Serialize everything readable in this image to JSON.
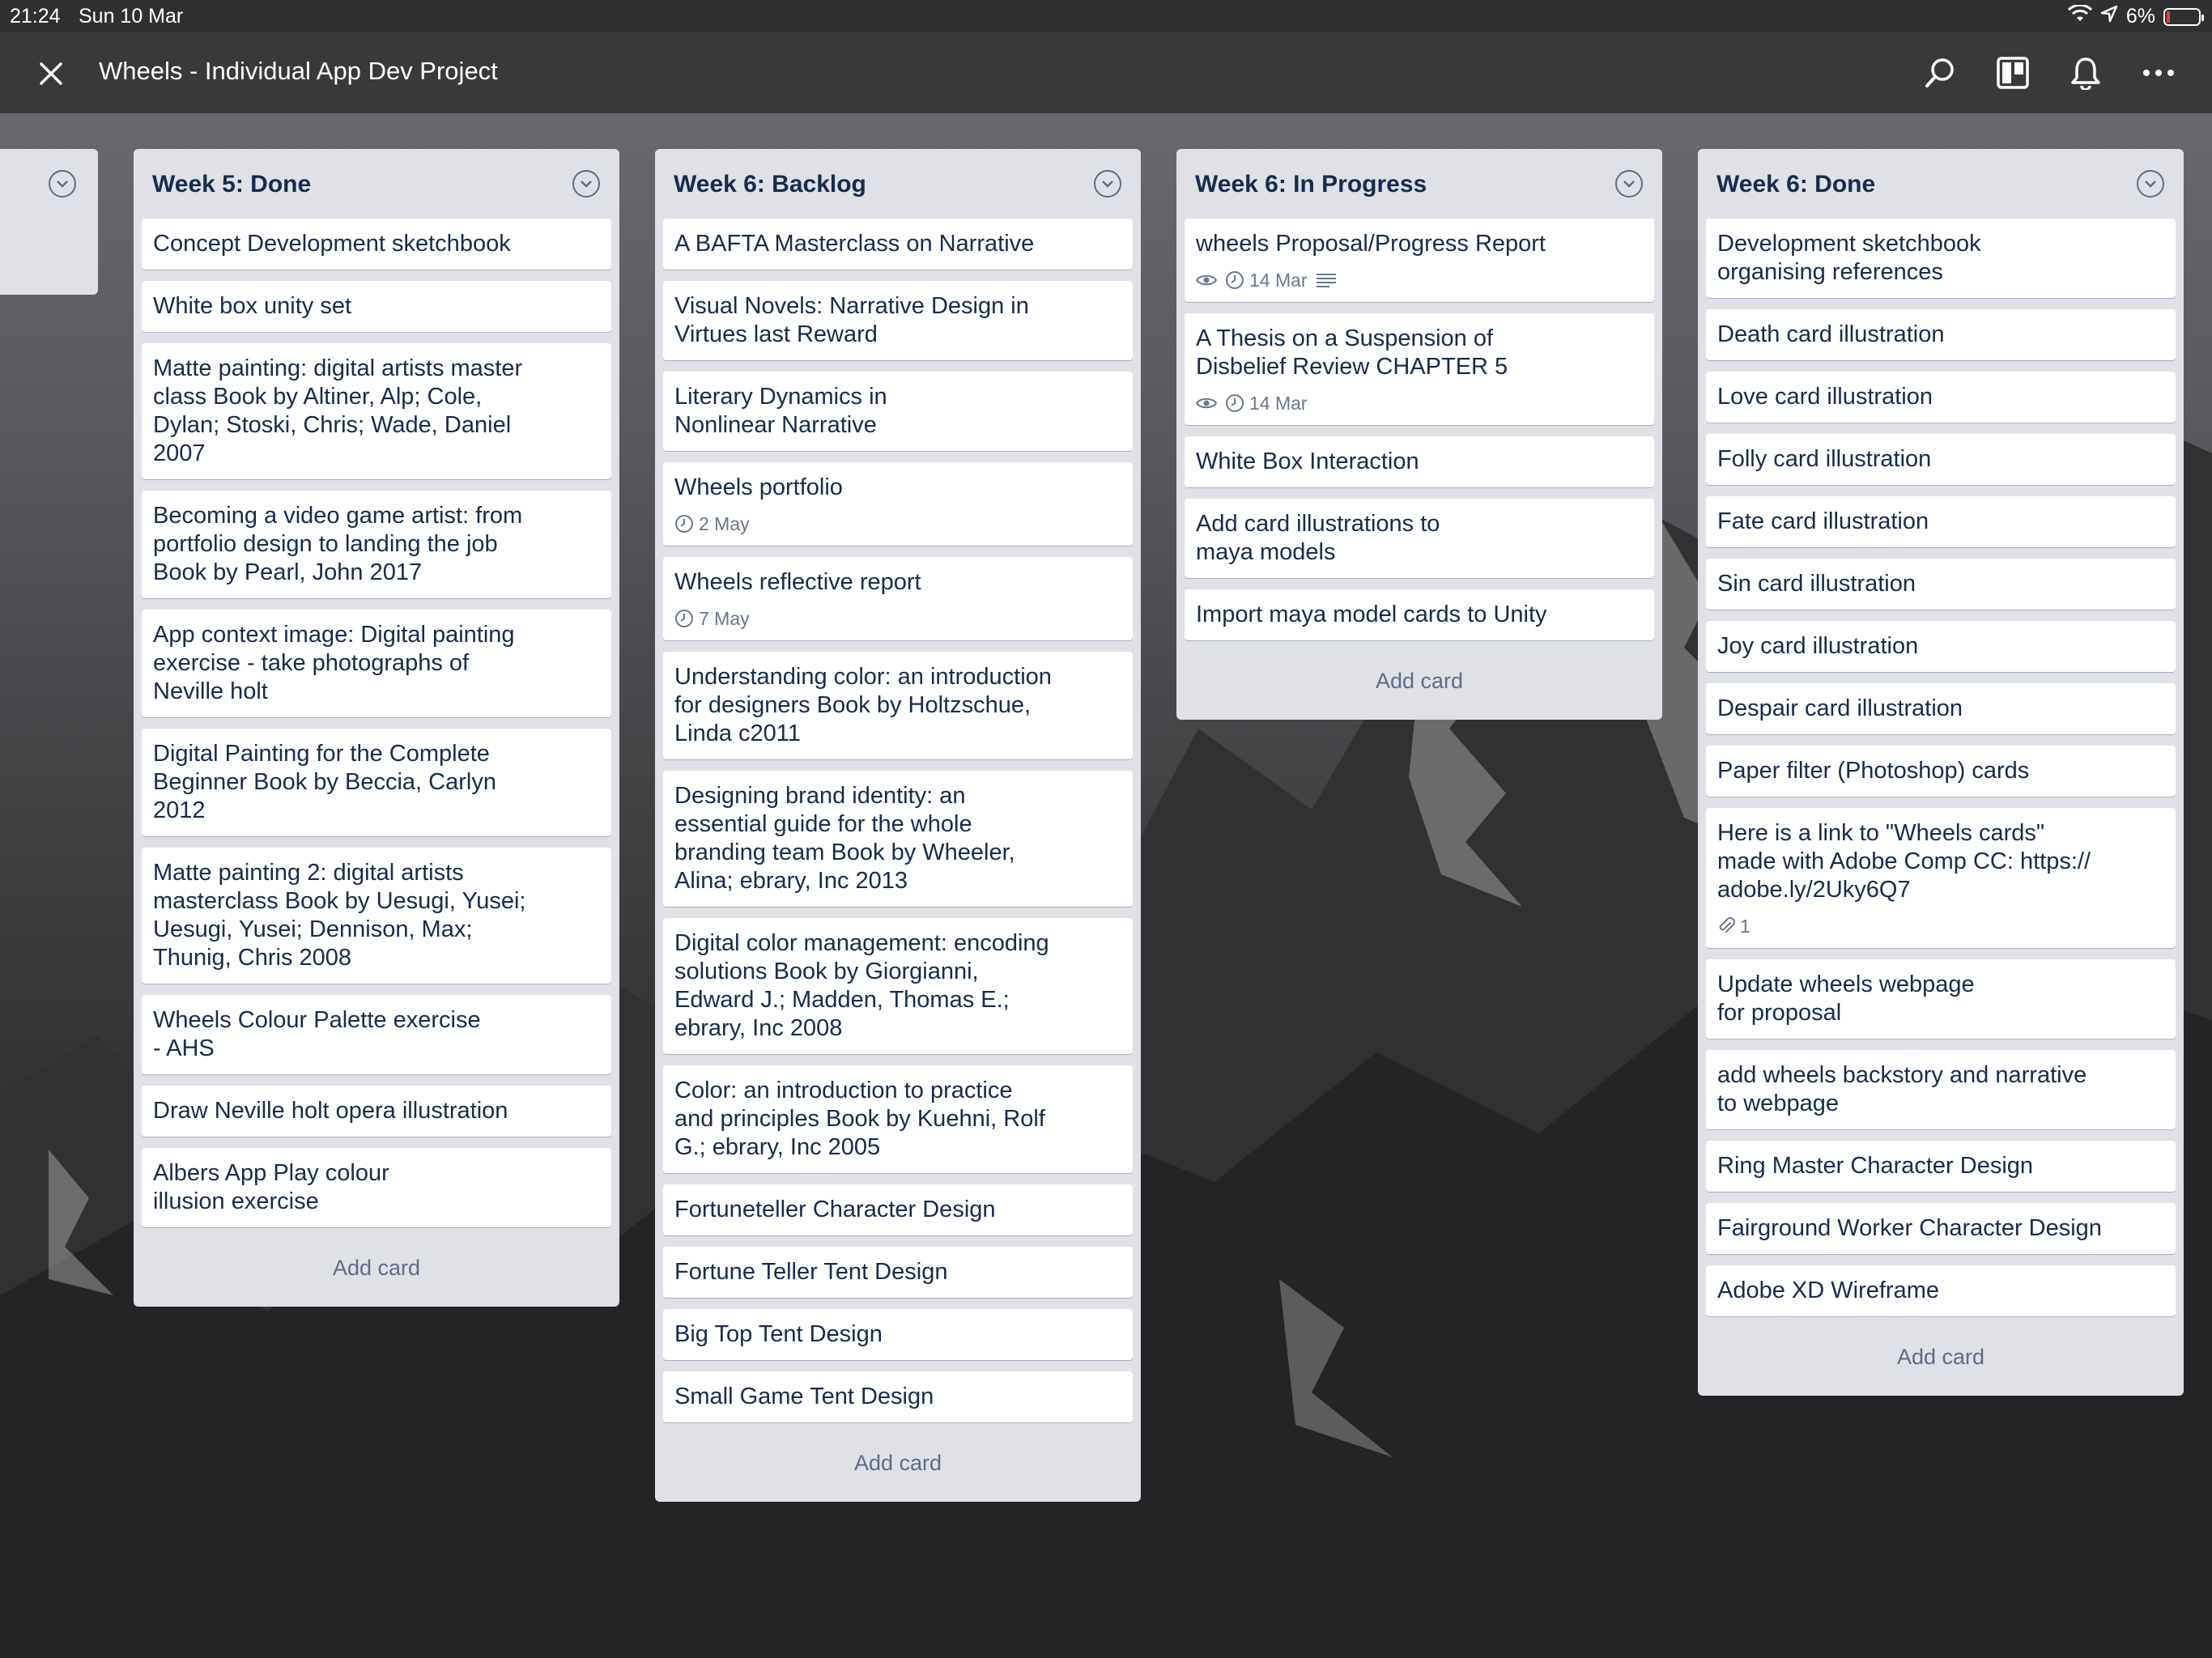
{
  "status_bar": {
    "time": "21:24",
    "date": "Sun 10 Mar",
    "battery": "6%"
  },
  "header": {
    "title": "Wheels - Individual App Dev Project",
    "close_icon": "close-icon",
    "icons": [
      "search-icon",
      "board-view-icon",
      "bell-icon",
      "more-icon"
    ]
  },
  "lists": [
    {
      "title": "Week 5: Done",
      "cards": [
        {
          "text": "Concept Development sketchbook"
        },
        {
          "text": "White box unity set"
        },
        {
          "text": "Matte painting: digital artists master\nclass Book  by Altiner, Alp; Cole,\nDylan; Stoski, Chris; Wade, Daniel\n2007"
        },
        {
          "text": "Becoming a video game artist: from\nportfolio design to landing the job\nBook  by Pearl, John  2017"
        },
        {
          "text": "App context image: Digital painting\nexercise - take photographs of\nNeville holt"
        },
        {
          "text": "Digital Painting for the Complete\nBeginner Book  by Beccia, Carlyn\n2012"
        },
        {
          "text": "Matte painting 2: digital artists\nmasterclass Book  by Uesugi, Yusei;\nUesugi, Yusei; Dennison, Max;\nThunig, Chris  2008"
        },
        {
          "text": "Wheels Colour Palette exercise\n- AHS"
        },
        {
          "text": "Draw Neville holt opera illustration"
        },
        {
          "text": "Albers App Play colour\nillusion exercise"
        }
      ],
      "add_label": "Add card"
    },
    {
      "title": "Week 6: Backlog",
      "cards": [
        {
          "text": "A BAFTA Masterclass on Narrative"
        },
        {
          "text": "Visual Novels: Narrative Design in\nVirtues last Reward"
        },
        {
          "text": "Literary Dynamics in\nNonlinear Narrative"
        },
        {
          "text": "Wheels portfolio",
          "due": "2 May"
        },
        {
          "text": "Wheels reflective report",
          "due": "7 May"
        },
        {
          "text": "Understanding color: an introduction\nfor designers Book  by Holtzschue,\nLinda  c2011"
        },
        {
          "text": "Designing brand identity: an\nessential guide for the whole\nbranding team Book  by Wheeler,\nAlina; ebrary, Inc  2013"
        },
        {
          "text": "Digital color management: encoding\nsolutions Book  by Giorgianni,\nEdward J.; Madden, Thomas E.;\nebrary, Inc  2008"
        },
        {
          "text": "Color: an introduction to practice\nand principles Book  by Kuehni, Rolf\nG.; ebrary, Inc  2005"
        },
        {
          "text": "Fortuneteller Character Design"
        },
        {
          "text": "Fortune Teller Tent Design"
        },
        {
          "text": "Big Top Tent Design"
        },
        {
          "text": "Small Game Tent Design"
        }
      ],
      "add_label": "Add card"
    },
    {
      "title": "Week 6: In Progress",
      "cards": [
        {
          "text": "wheels Proposal/Progress Report",
          "watch": true,
          "due": "14 Mar",
          "description": true
        },
        {
          "text": "A Thesis on a Suspension of\nDisbelief Review CHAPTER 5",
          "watch": true,
          "due": "14 Mar"
        },
        {
          "text": "White Box Interaction"
        },
        {
          "text": "Add card illustrations to\nmaya models"
        },
        {
          "text": "Import maya model cards to Unity"
        }
      ],
      "add_label": "Add card"
    },
    {
      "title": "Week 6: Done",
      "cards": [
        {
          "text": "Development sketchbook\norganising references"
        },
        {
          "text": "Death card illustration"
        },
        {
          "text": "Love card illustration"
        },
        {
          "text": "Folly card illustration"
        },
        {
          "text": "Fate card illustration"
        },
        {
          "text": "Sin card illustration"
        },
        {
          "text": "Joy card illustration"
        },
        {
          "text": "Despair card illustration"
        },
        {
          "text": "Paper filter (Photoshop) cards"
        },
        {
          "text": "Here is a link to \"Wheels cards\"\nmade with Adobe Comp CC: https://\nadobe.ly/2Uky6Q7",
          "attachments": "1"
        },
        {
          "text": "Update wheels webpage\nfor proposal"
        },
        {
          "text": "add wheels backstory and narrative\nto webpage"
        },
        {
          "text": "Ring Master Character Design"
        },
        {
          "text": "Fairground Worker Character Design"
        },
        {
          "text": "Adobe XD Wireframe"
        }
      ],
      "add_label": "Add card"
    }
  ]
}
